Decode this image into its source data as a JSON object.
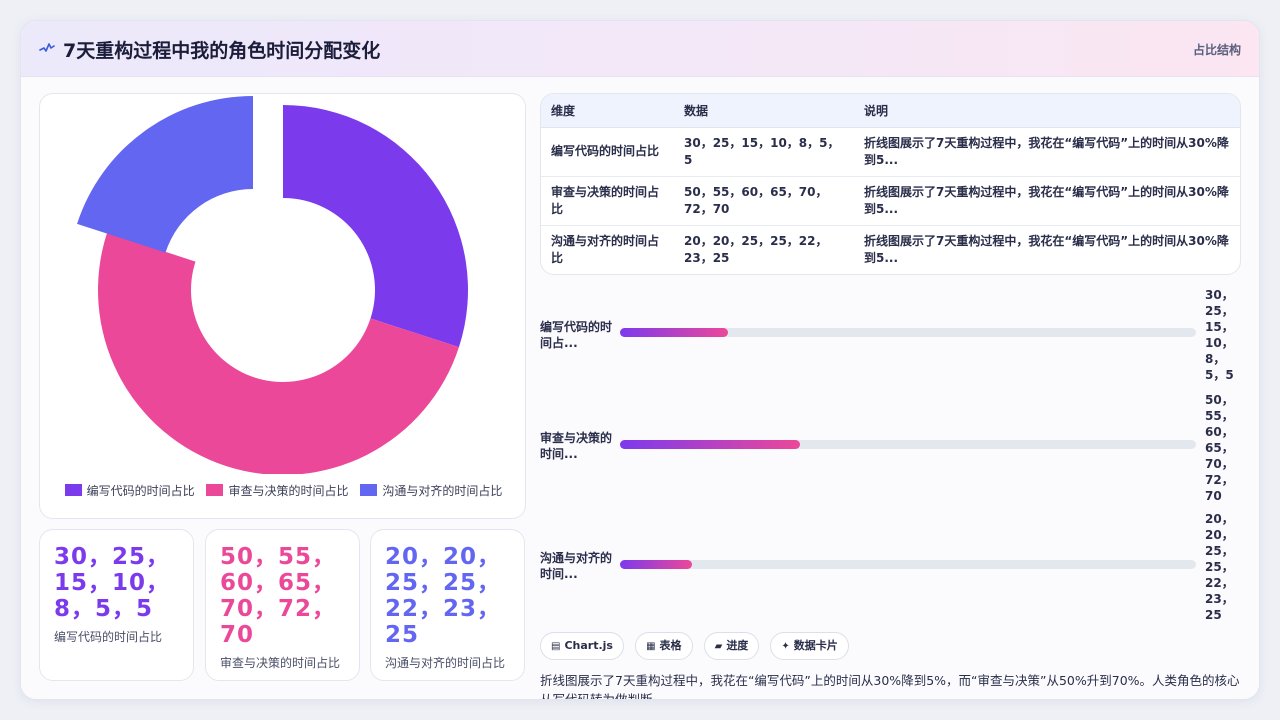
{
  "header": {
    "title": "7天重构过程中我的角色时间分配变化",
    "tag": "占比结构",
    "icon": "pulse-icon"
  },
  "colors": {
    "coding": "#7c3aed",
    "review": "#ec4899",
    "comms": "#6366f1"
  },
  "chart_data": {
    "type": "pie",
    "variant": "doughnut",
    "categories": [
      "编写代码的时间占比",
      "审查与决策的时间占比",
      "沟通与对齐的时间占比"
    ],
    "values": [
      30,
      50,
      20
    ],
    "legend_position": "bottom"
  },
  "stats": [
    {
      "value": "30，25，15，10，8，5，5",
      "label": "编写代码的时间占比"
    },
    {
      "value": "50，55，60，65，70，72，70",
      "label": "审查与决策的时间占比"
    },
    {
      "value": "20，20，25，25，22，23，25",
      "label": "沟通与对齐的时间占比"
    }
  ],
  "table": {
    "headers": [
      "维度",
      "数据",
      "说明"
    ],
    "rows": [
      {
        "dim": "编写代码的时间占比",
        "data": "30，25，15，10，8，5，5",
        "note": "折线图展示了7天重构过程中，我花在“编写代码”上的时间从30%降到5..."
      },
      {
        "dim": "审查与决策的时间占比",
        "data": "50，55，60，65，70，72，70",
        "note": "折线图展示了7天重构过程中，我花在“编写代码”上的时间从30%降到5..."
      },
      {
        "dim": "沟通与对齐的时间占比",
        "data": "20，20，25，25，22，23，25",
        "note": "折线图展示了7天重构过程中，我花在“编写代码”上的时间从30%降到5..."
      }
    ]
  },
  "progress": [
    {
      "label": "编写代码的时间占...",
      "value": "30，25，15，10，8，5，5",
      "fraction": 0.187
    },
    {
      "label": "审查与决策的时间...",
      "value": "50，55，60，65，70，72，70",
      "fraction": 0.312
    },
    {
      "label": "沟通与对齐的时间...",
      "value": "20，20，25，25，22，23，25",
      "fraction": 0.125
    }
  ],
  "chips": [
    {
      "icon": "chart-icon",
      "label": "Chart.js"
    },
    {
      "icon": "table-icon",
      "label": "表格"
    },
    {
      "icon": "progress-icon",
      "label": "进度"
    },
    {
      "icon": "sparkle-icon",
      "label": "数据卡片"
    }
  ],
  "description": "折线图展示了7天重构过程中，我花在“编写代码”上的时间从30%降到5%，而“审查与决策”从50%升到70%。人类角色的核心从写代码转为做判断。"
}
